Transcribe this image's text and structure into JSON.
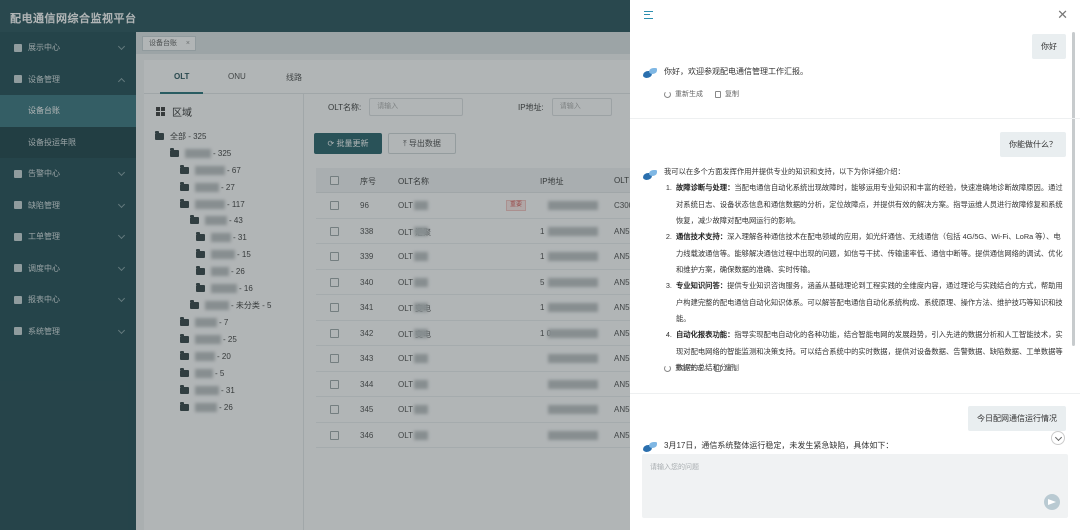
{
  "app": {
    "title": "配电通信网综合监视平台"
  },
  "sidebar": {
    "items": [
      {
        "label": "展示中心",
        "icon": "monitor-icon"
      },
      {
        "label": "设备管理",
        "icon": "gear-icon"
      },
      {
        "label": "设备台账",
        "sub": true,
        "active": true
      },
      {
        "label": "设备投运年限",
        "sub": true
      },
      {
        "label": "告警中心",
        "icon": "alert-icon"
      },
      {
        "label": "缺陷管理",
        "icon": "wrench-icon"
      },
      {
        "label": "工单管理",
        "icon": "ticket-icon"
      },
      {
        "label": "调度中心",
        "icon": "location-icon"
      },
      {
        "label": "报表中心",
        "icon": "report-icon"
      },
      {
        "label": "系统管理",
        "icon": "settings-icon"
      }
    ]
  },
  "tabstrip": {
    "tab_label": "设备台账",
    "close": "×"
  },
  "main": {
    "tabs": [
      "OLT",
      "ONU",
      "线路"
    ],
    "area_title": "区域",
    "tree": [
      {
        "label": "全部 - 325"
      },
      {
        "label": "- 325"
      },
      {
        "label": "- 67"
      },
      {
        "label": "- 27"
      },
      {
        "label": "- 117"
      },
      {
        "label": "- 43"
      },
      {
        "label": "- 31"
      },
      {
        "label": "- 15"
      },
      {
        "label": "- 26"
      },
      {
        "label": "- 16"
      },
      {
        "label": "- 未分类 - 5"
      },
      {
        "label": "- 7"
      },
      {
        "label": "- 25"
      },
      {
        "label": "- 20"
      },
      {
        "label": "- 5"
      },
      {
        "label": "- 31"
      },
      {
        "label": "- 26"
      }
    ],
    "filters": {
      "olt_name_label": "OLT名称:",
      "olt_name_placeholder": "请输入",
      "ip_label": "IP地址:",
      "ip_placeholder": "请输入"
    },
    "batch_update": "批量更新",
    "export": "导出数据",
    "table": {
      "headers": [
        "序号",
        "OLT名称",
        "IP地址",
        "OLT"
      ],
      "rows": [
        {
          "idx": "96",
          "name": "OLT",
          "ip": "",
          "model": "C300",
          "tag": "重要"
        },
        {
          "idx": "338",
          "name": "OLT  汇聚",
          "ip": "1",
          "model": "AN5"
        },
        {
          "idx": "339",
          "name": "OLT",
          "ip": "1",
          "model": "AN5"
        },
        {
          "idx": "340",
          "name": "OLT",
          "ip": "5",
          "model": "AN5"
        },
        {
          "idx": "341",
          "name": "OLT  变电",
          "ip": "1",
          "model": "AN5"
        },
        {
          "idx": "342",
          "name": "OLT  变电",
          "ip": "1  0",
          "model": "AN5"
        },
        {
          "idx": "343",
          "name": "OLT",
          "ip": "",
          "model": "AN5"
        },
        {
          "idx": "344",
          "name": "OLT",
          "ip": "",
          "model": "AN5"
        },
        {
          "idx": "345",
          "name": "OLT",
          "ip": "",
          "model": "AN5"
        },
        {
          "idx": "346",
          "name": "OLT",
          "ip": "",
          "model": "AN5"
        }
      ]
    }
  },
  "chat": {
    "messages": [
      {
        "role": "user",
        "text": "你好"
      },
      {
        "role": "bot",
        "text": "你好，欢迎参观配电通信管理工作汇报。"
      },
      {
        "role": "user",
        "text": "你能做什么？"
      },
      {
        "role": "bot",
        "intro": "我可以在多个方面发挥作用并提供专业的知识和支持，以下为你详细介绍：",
        "items": [
          {
            "title": "故障诊断与处理：",
            "body": "当配电通信自动化系统出现故障时，能够运用专业知识和丰富的经验，快速准确地诊断故障原因。通过对系统日志、设备状态信息和通信数据的分析，定位故障点，并提供有效的解决方案。指导运维人员进行故障修复和系统恢复，减少故障对配电网运行的影响。"
          },
          {
            "title": "通信技术支持：",
            "body": "深入理解各种通信技术在配电领域的应用，如光纤通信、无线通信（包括 4G/5G、Wi-Fi、LoRa 等）、电力线载波通信等。能够解决通信过程中出现的问题，如信号干扰、传输速率低、通信中断等。提供通信网络的调试、优化和维护方案，确保数据的准确、实时传输。"
          },
          {
            "title": "专业知识问答：",
            "body": "提供专业知识咨询服务，涵盖从基础理论到工程实践的全维度内容，通过理论与实践结合的方式，帮助用户构建完整的配电通信自动化知识体系。可以解答配电通信自动化系统构成、系统原理、操作方法、维护技巧等知识和技能。"
          },
          {
            "title": "自动化报表功能：",
            "body": "指导实现配电自动化的各种功能，结合智能电网的发展趋势，引入先进的数据分析和人工智能技术，实现对配电网络的智能监测和决策支持。可以结合系统中的实时数据，提供对设备数据、告警数据、缺陷数据、工单数据等数据的总结和分析。"
          }
        ]
      },
      {
        "role": "user",
        "text": "今日配网通信运行情况"
      },
      {
        "role": "bot",
        "text": "3月17日，通信系统整体运行稳定，未发生紧急缺陷，具体如下："
      }
    ],
    "actions": {
      "regenerate": "重新生成",
      "copy": "复制"
    },
    "input_placeholder": "请输入您的问题"
  },
  "colors": {
    "header_bg": "#1d4a52",
    "sidebar_bg": "#17434b",
    "primary_button": "#1d5b63",
    "chat_accent": "#2c8fb0"
  }
}
